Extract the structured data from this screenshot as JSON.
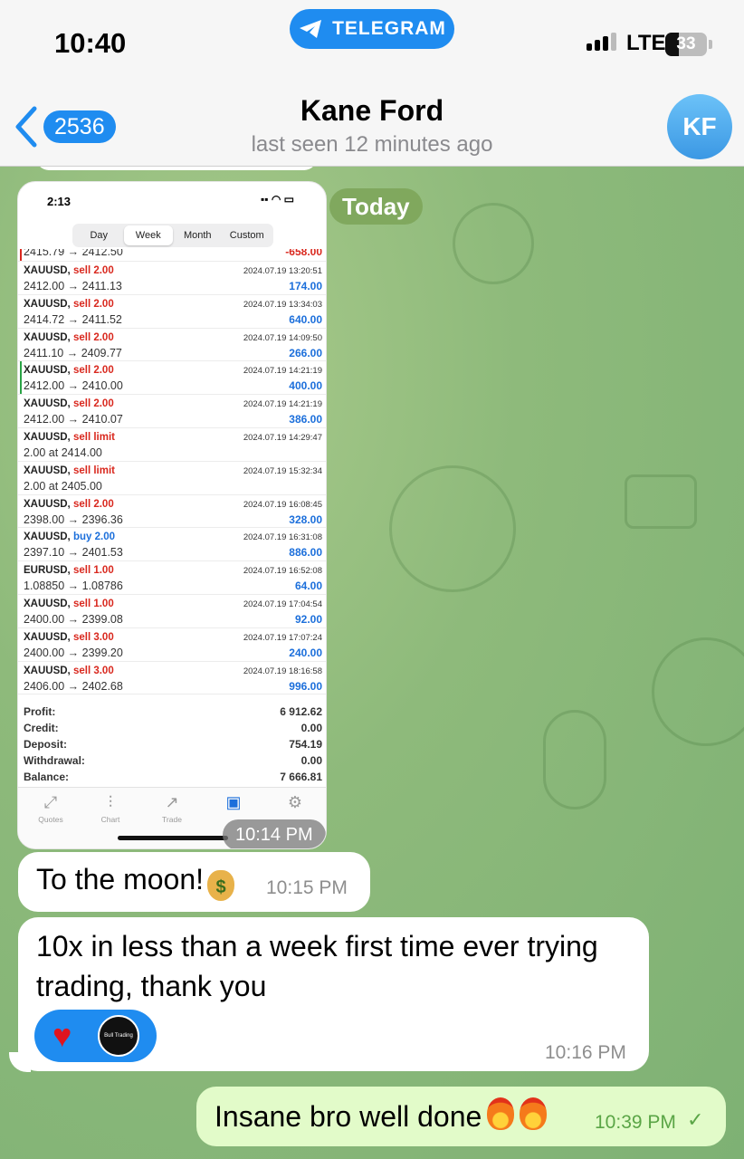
{
  "status_bar": {
    "time": "10:40",
    "app_pill": "TELEGRAM",
    "network": "LTE",
    "battery": "33",
    "battery_level": 0.33
  },
  "header": {
    "back_count": "2536",
    "contact_name": "Kane Ford",
    "last_seen": "last seen 12 minutes ago",
    "avatar_initials": "KF"
  },
  "date_chip": "Today",
  "screenshot": {
    "time": "2:13",
    "segments": [
      "Day",
      "Week",
      "Month",
      "Custom"
    ],
    "active_segment": "Week",
    "cut_row": {
      "prices": "2415.79 → 2412.50",
      "profit": "-658.00"
    },
    "trades": [
      {
        "symbol": "XAUUSD,",
        "side": "sell 2.00",
        "type": "sell",
        "prices": "2412.00 → 2411.13",
        "datetime": "2024.07.19 13:20:51",
        "profit": "174.00"
      },
      {
        "symbol": "XAUUSD,",
        "side": "sell 2.00",
        "type": "sell",
        "prices": "2414.72 → 2411.52",
        "datetime": "2024.07.19 13:34:03",
        "profit": "640.00"
      },
      {
        "symbol": "XAUUSD,",
        "side": "sell 2.00",
        "type": "sell",
        "prices": "2411.10 → 2409.77",
        "datetime": "2024.07.19 14:09:50",
        "profit": "266.00"
      },
      {
        "symbol": "XAUUSD,",
        "side": "sell 2.00",
        "type": "sell",
        "prices": "2412.00 → 2410.00",
        "datetime": "2024.07.19 14:21:19",
        "profit": "400.00"
      },
      {
        "symbol": "XAUUSD,",
        "side": "sell 2.00",
        "type": "sell",
        "prices": "2412.00 → 2410.07",
        "datetime": "2024.07.19 14:21:19",
        "profit": "386.00"
      },
      {
        "symbol": "XAUUSD,",
        "side": "sell limit",
        "type": "sell",
        "prices": "2.00 at 2414.00",
        "datetime": "2024.07.19 14:29:47",
        "profit": ""
      },
      {
        "symbol": "XAUUSD,",
        "side": "sell limit",
        "type": "sell",
        "prices": "2.00 at 2405.00",
        "datetime": "2024.07.19 15:32:34",
        "profit": ""
      },
      {
        "symbol": "XAUUSD,",
        "side": "sell 2.00",
        "type": "sell",
        "prices": "2398.00 → 2396.36",
        "datetime": "2024.07.19 16:08:45",
        "profit": "328.00"
      },
      {
        "symbol": "XAUUSD,",
        "side": "buy 2.00",
        "type": "buy",
        "prices": "2397.10 → 2401.53",
        "datetime": "2024.07.19 16:31:08",
        "profit": "886.00"
      },
      {
        "symbol": "EURUSD,",
        "side": "sell 1.00",
        "type": "sell",
        "prices": "1.08850 → 1.08786",
        "datetime": "2024.07.19 16:52:08",
        "profit": "64.00"
      },
      {
        "symbol": "XAUUSD,",
        "side": "sell 1.00",
        "type": "sell",
        "prices": "2400.00 → 2399.08",
        "datetime": "2024.07.19 17:04:54",
        "profit": "92.00"
      },
      {
        "symbol": "XAUUSD,",
        "side": "sell 3.00",
        "type": "sell",
        "prices": "2400.00 → 2399.20",
        "datetime": "2024.07.19 17:07:24",
        "profit": "240.00"
      },
      {
        "symbol": "XAUUSD,",
        "side": "sell 3.00",
        "type": "sell",
        "prices": "2406.00 → 2402.68",
        "datetime": "2024.07.19 18:16:58",
        "profit": "996.00"
      }
    ],
    "summary": [
      {
        "label": "Profit:",
        "value": "6 912.62"
      },
      {
        "label": "Credit:",
        "value": "0.00"
      },
      {
        "label": "Deposit:",
        "value": "754.19"
      },
      {
        "label": "Withdrawal:",
        "value": "0.00"
      },
      {
        "label": "Balance:",
        "value": "7 666.81"
      }
    ],
    "tabs": [
      "Quotes",
      "Chart",
      "Trade",
      "",
      ""
    ],
    "photo_time": "10:14 PM"
  },
  "messages": [
    {
      "text": "To the moon!",
      "time": "10:15 PM",
      "emoji": "money-bag"
    },
    {
      "text": "10x in less than a week first time ever trying trading, thank you",
      "time": "10:16 PM",
      "reactions": [
        "heart",
        "avatar"
      ],
      "reaction_avatar_text": "Bull Trading"
    },
    {
      "text": "Insane bro well done",
      "time": "10:39 PM",
      "emoji": "fire x2",
      "status": "sent-check"
    }
  ],
  "colors": {
    "accent": "#1f8cf0",
    "outgoing_bubble": "#e2fbc9",
    "chat_bg": "#8eba7b",
    "sell": "#d9281e",
    "buy": "#1c6fdb"
  }
}
